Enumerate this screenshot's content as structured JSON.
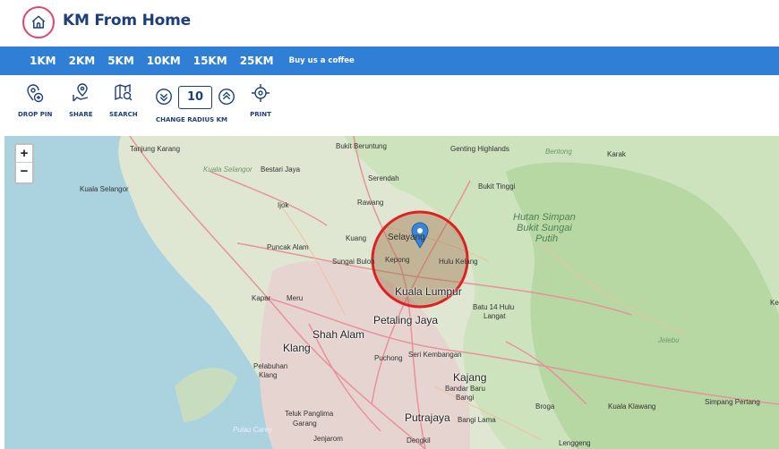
{
  "app": {
    "title": "KM From Home",
    "logo_icon": "home-icon",
    "accent": "#e0476a",
    "brand": "#1d3f7a"
  },
  "nav": {
    "color": "#2f7fd6",
    "items": [
      {
        "label": "1KM"
      },
      {
        "label": "2KM"
      },
      {
        "label": "5KM"
      },
      {
        "label": "10KM"
      },
      {
        "label": "15KM"
      },
      {
        "label": "25KM"
      }
    ],
    "coffee_label": "Buy us a coffee"
  },
  "toolbar": {
    "drop_pin": "DROP PIN",
    "share": "SHARE",
    "search": "SEARCH",
    "change_radius": "CHANGE RADIUS KM",
    "print": "PRINT",
    "radius_value": "10"
  },
  "map": {
    "zoom_in": "+",
    "zoom_out": "−",
    "circle_color": "#e02020",
    "labels": {
      "tanjung_karang": "Tanjung Karang",
      "kuala_selangor_it": "Kuala Selangor",
      "bestari_jaya": "Bestari Jaya",
      "kuala_selangor": "Kuala Selangor",
      "ijok": "Ijok",
      "bukit_beruntung": "Bukit Beruntung",
      "serendah": "Serendah",
      "rawang": "Rawang",
      "genting": "Genting Highlands",
      "bukit_tinggi": "Bukit Tinggi",
      "bentong": "Bentong",
      "karak": "Karak",
      "hutan_simpan": "Hutan Simpan",
      "bukit_sungai": "Bukit Sungai",
      "putih": "Putih",
      "puncak_alam": "Puncak Alam",
      "kuang": "Kuang",
      "selayang": "Selayang",
      "sungai_buloh": "Sungai Buloh",
      "kepong": "Kepong",
      "hulu_kelang": "Hulu Kelang",
      "kuala_lumpur": "Kuala Lumpur",
      "batu_14": "Batu 14 Hulu",
      "langat": "Langat",
      "kapar": "Kapar",
      "meru": "Meru",
      "petaling_jaya": "Petaling Jaya",
      "shah_alam": "Shah Alam",
      "klang": "Klang",
      "pelabuhan": "Pelabuhan",
      "klang2": "Klang",
      "puchong": "Puchong",
      "seri_kembangan": "Seri Kembangan",
      "kajang": "Kajang",
      "bandar_baru": "Bandar Baru",
      "bangi": "Bangi",
      "jelebu": "Jelebu",
      "broga": "Broga",
      "kuala_klawang": "Kuala Klawang",
      "simpang_pertang": "Simpang Pertang",
      "teluk_panglima": "Teluk Panglima",
      "garang": "Garang",
      "putrajaya": "Putrajaya",
      "bangi_lama": "Bangi Lama",
      "pulau_carey": "Pulau Carey",
      "jenjarom": "Jenjarom",
      "dengkil": "Dengkil",
      "lenggeng": "Lenggeng",
      "ke": "Ke"
    }
  }
}
